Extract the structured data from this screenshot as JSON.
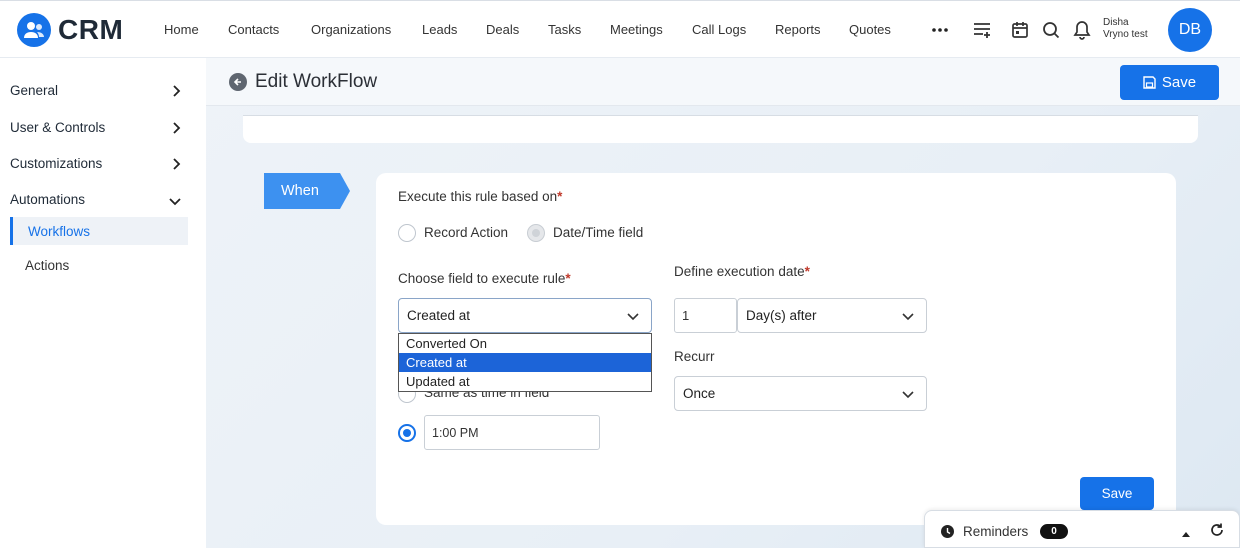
{
  "brand": {
    "name": "CRM",
    "color": "#1672e8"
  },
  "nav": {
    "items": [
      "Home",
      "Contacts",
      "Organizations",
      "Leads",
      "Deals",
      "Tasks",
      "Meetings",
      "Call Logs",
      "Reports",
      "Quotes"
    ],
    "icons": [
      "more-icon",
      "filter-list-icon",
      "calendar-icon",
      "search-icon",
      "bell-icon"
    ]
  },
  "user": {
    "line1": "Disha",
    "line2": "Vryno test",
    "initials": "DB"
  },
  "sidebar": {
    "groups": [
      {
        "label": "General",
        "expanded": false
      },
      {
        "label": "User & Controls",
        "expanded": false
      },
      {
        "label": "Customizations",
        "expanded": false
      },
      {
        "label": "Automations",
        "expanded": true
      }
    ],
    "subitems": [
      {
        "label": "Workflows",
        "active": true
      },
      {
        "label": "Actions",
        "active": false
      }
    ]
  },
  "header": {
    "title": "Edit WorkFlow",
    "save_label": "Save"
  },
  "when": {
    "tag": "When",
    "execute_label": "Execute this rule based on",
    "required_mark": "*",
    "options": {
      "record_action": "Record Action",
      "date_time_field": "Date/Time field"
    },
    "choose_field_label": "Choose field to execute rule",
    "selected_field": "Created at",
    "field_options": [
      "Converted On",
      "Created at",
      "Updated at"
    ],
    "define_date_label": "Define execution date",
    "offset_value": "1",
    "offset_unit": "Day(s) after",
    "same_time_label": "Same as time in field",
    "time_value": "1:00 PM",
    "recurr_label": "Recurr",
    "recurr_value": "Once",
    "save_label": "Save"
  },
  "reminders": {
    "label": "Reminders",
    "count": "0"
  }
}
